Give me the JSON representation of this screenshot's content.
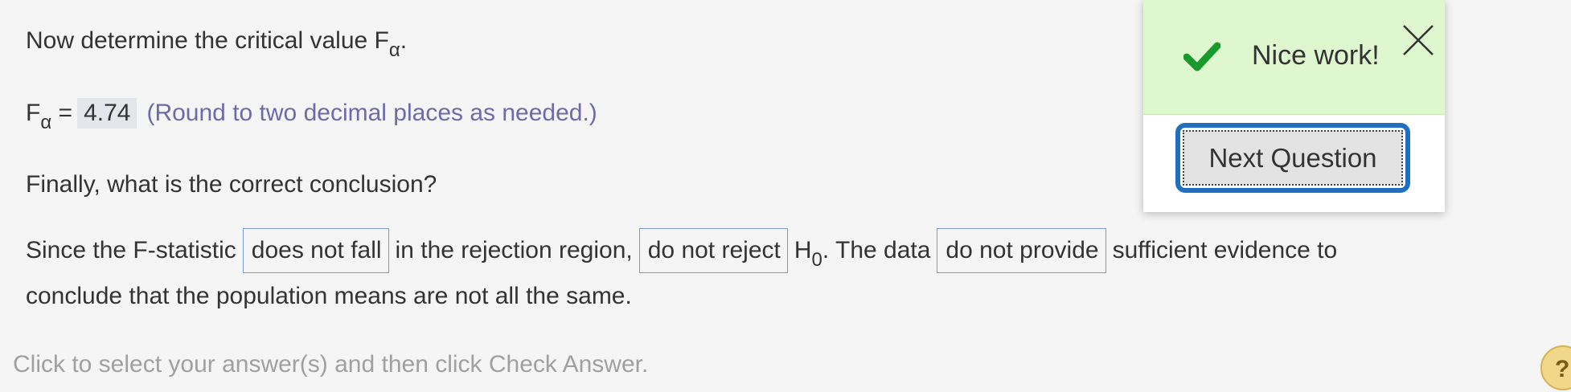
{
  "question": {
    "critical_prefix": "Now determine the critical value F",
    "alpha": "α",
    "period": ".",
    "f_label": "F",
    "equals": "=",
    "answer_value": "4.74",
    "round_hint": "(Round to two decimal places as needed.)",
    "conclusion_prompt": "Finally, what is the correct conclusion?",
    "since_text": "Since the F-statistic",
    "dropdown1": "does not fall",
    "region_text": "in the rejection region,",
    "dropdown2": "do not reject",
    "h_label": "H",
    "h_sub": "0",
    "data_text": ". The data",
    "dropdown3": "do not provide",
    "evidence_text": "sufficient evidence to",
    "line2_text": "conclude that the population means are not all the same."
  },
  "instructions": "Click to select your answer(s) and then click Check Answer.",
  "help_icon": "?",
  "popup": {
    "message": "Nice work!",
    "next_button": "Next Question",
    "icons": [
      "check-icon",
      "close-icon"
    ]
  },
  "colors": {
    "hint": "#6d6aa8",
    "success_bg": "#dff7cf",
    "check": "#1a9a2c",
    "focus_ring": "#1f6fc1",
    "dropdown_border": "#7b9bd0"
  }
}
